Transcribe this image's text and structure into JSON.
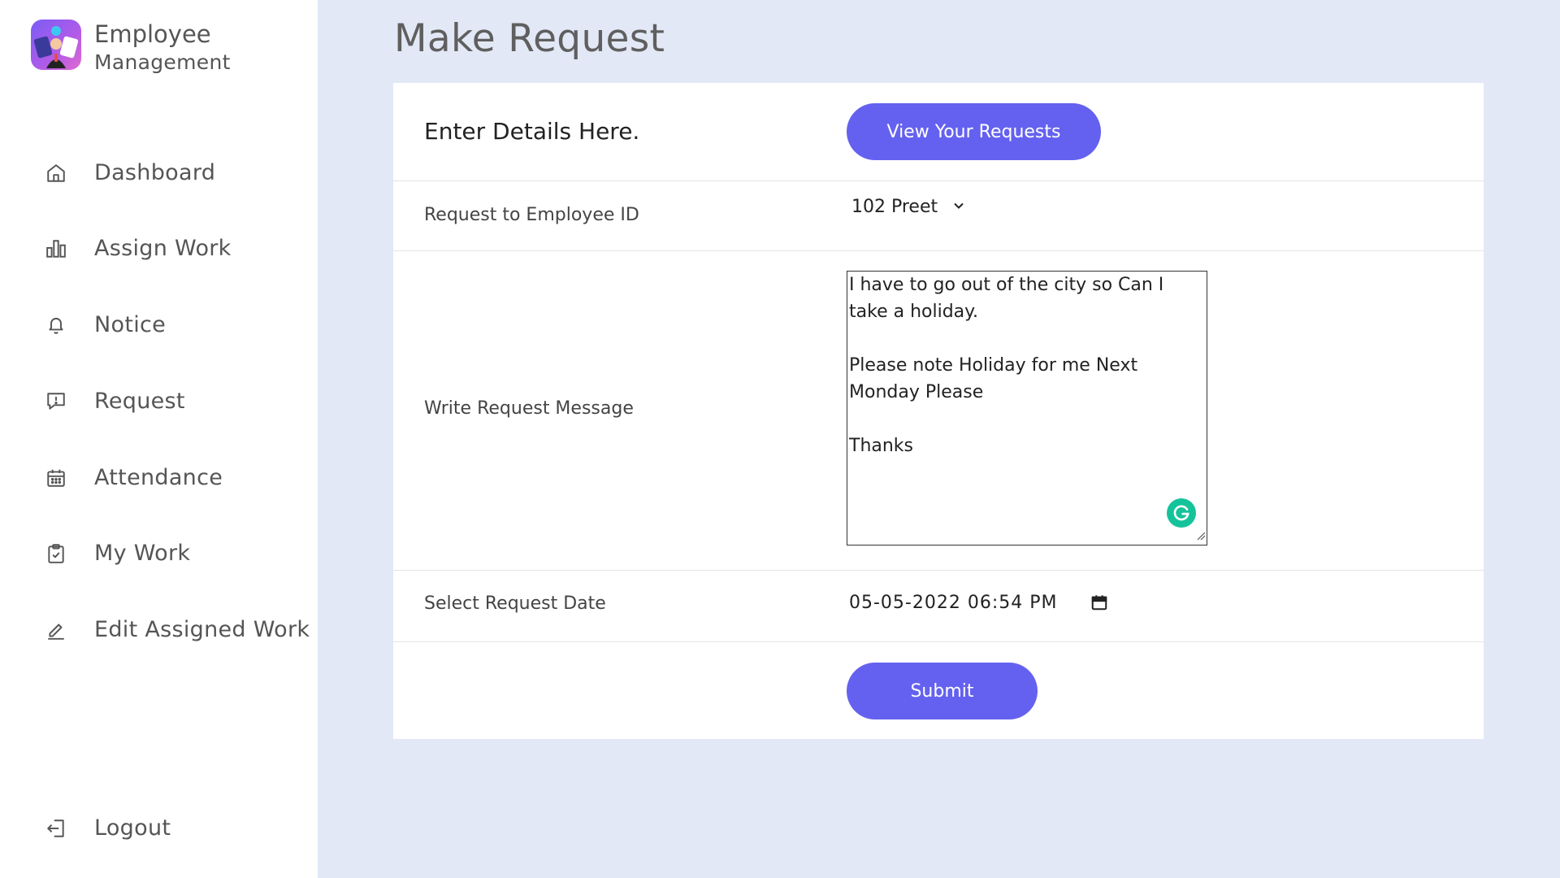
{
  "brand": {
    "title": "Employee",
    "subtitle": "Management",
    "logo": "employee-team-logo"
  },
  "sidebar": {
    "items": [
      {
        "label": "Dashboard",
        "icon": "home-icon"
      },
      {
        "label": "Assign Work",
        "icon": "bar-chart-icon"
      },
      {
        "label": "Notice",
        "icon": "bell-icon"
      },
      {
        "label": "Request",
        "icon": "message-alert-icon"
      },
      {
        "label": "Attendance",
        "icon": "calendar-icon"
      },
      {
        "label": "My Work",
        "icon": "clipboard-check-icon"
      },
      {
        "label": "Edit Assigned Work",
        "icon": "pencil-icon"
      }
    ],
    "logout": {
      "label": "Logout",
      "icon": "logout-icon"
    }
  },
  "main": {
    "title": "Make Request",
    "form": {
      "header": "Enter Details Here.",
      "view_requests_label": "View Your Requests",
      "employee_label": "Request to Employee ID",
      "employee_value": "102 Preet",
      "message_label": "Write Request Message",
      "message_value": "I have to go out of the city so Can I take a holiday.\n\nPlease note Holiday for me Next Monday Please\n\nThanks",
      "date_label": "Select Request Date",
      "date_value": "05-05-2022 06:54 PM",
      "submit_label": "Submit"
    }
  },
  "colors": {
    "accent": "#6461f0",
    "background": "#e3e8f6",
    "grammarly": "#15c39a"
  }
}
